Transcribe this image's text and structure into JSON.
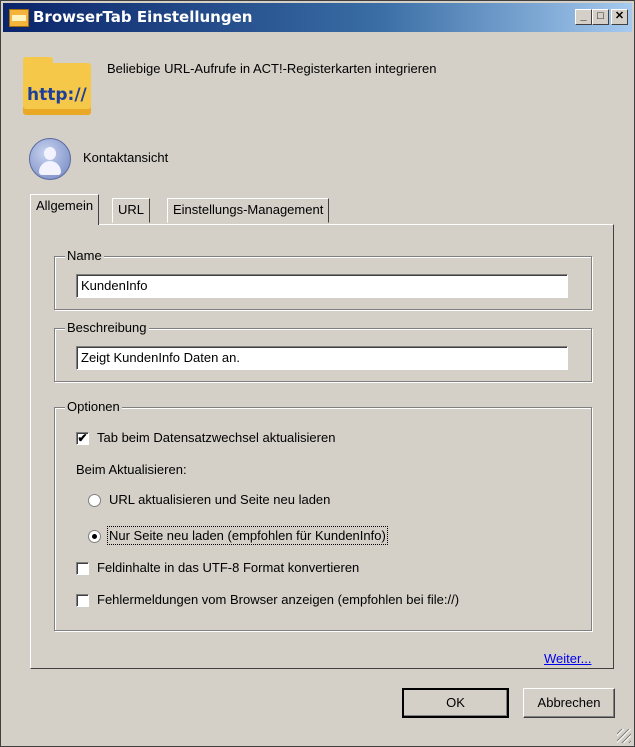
{
  "window": {
    "title": "BrowserTab Einstellungen",
    "controls": {
      "minimize": "_",
      "maximize": "□",
      "close": "✕"
    }
  },
  "header": {
    "icon_text": "http://",
    "description": "Beliebige URL-Aufrufe in ACT!-Registerkarten integrieren"
  },
  "context": {
    "label": "Kontaktansicht"
  },
  "tabs": [
    {
      "label": "Allgemein",
      "active": true
    },
    {
      "label": "URL",
      "active": false
    },
    {
      "label": "Einstellungs-Management",
      "active": false
    }
  ],
  "name_group": {
    "legend": "Name",
    "value": "KundenInfo"
  },
  "description_group": {
    "legend": "Beschreibung",
    "value": "Zeigt KundenInfo Daten an."
  },
  "options": {
    "legend": "Optionen",
    "refresh_on_record_change": {
      "label": "Tab beim Datensatzwechsel aktualisieren",
      "checked": true
    },
    "on_refresh_label": "Beim Aktualisieren:",
    "radio_url_reload": {
      "label": "URL aktualisieren und Seite neu laden",
      "checked": false
    },
    "radio_page_reload": {
      "label": "Nur Seite neu laden (empfohlen für KundenInfo)",
      "checked": true
    },
    "utf8_convert": {
      "label": "Feldinhalte in das UTF-8 Format konvertieren",
      "checked": false
    },
    "show_browser_errors": {
      "label": "Fehlermeldungen vom Browser anzeigen (empfohlen bei file://)",
      "checked": false
    }
  },
  "more_link": "Weiter...",
  "buttons": {
    "ok": "OK",
    "cancel": "Abbrechen"
  },
  "colors": {
    "titlebar_start": "#0a246a",
    "titlebar_end": "#a6caf0",
    "dialog_bg": "#d4d0c8",
    "link": "#0000ee"
  }
}
